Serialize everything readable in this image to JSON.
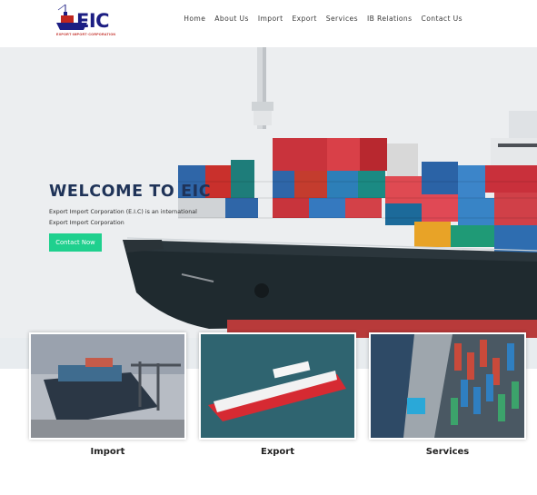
{
  "logo": {
    "text": "EIC",
    "tagline": "EXPORT·IMPORT·CORPORATION"
  },
  "nav": {
    "items": [
      {
        "label": "Home"
      },
      {
        "label": "About Us"
      },
      {
        "label": "Import"
      },
      {
        "label": "Export"
      },
      {
        "label": "Services"
      },
      {
        "label": "IB Relations"
      },
      {
        "label": "Contact Us"
      }
    ]
  },
  "hero": {
    "title": "WELCOME TO EIC",
    "line1": "Export Import Corporation (E.I.C) is an international",
    "line2": "Export Import Corporation",
    "button_label": "Contact Now"
  },
  "cards": [
    {
      "label": "Import"
    },
    {
      "label": "Export"
    },
    {
      "label": "Services"
    }
  ],
  "colors": {
    "accent": "#1fd08e",
    "title": "#1f3358",
    "logo": "#1c1e83"
  }
}
